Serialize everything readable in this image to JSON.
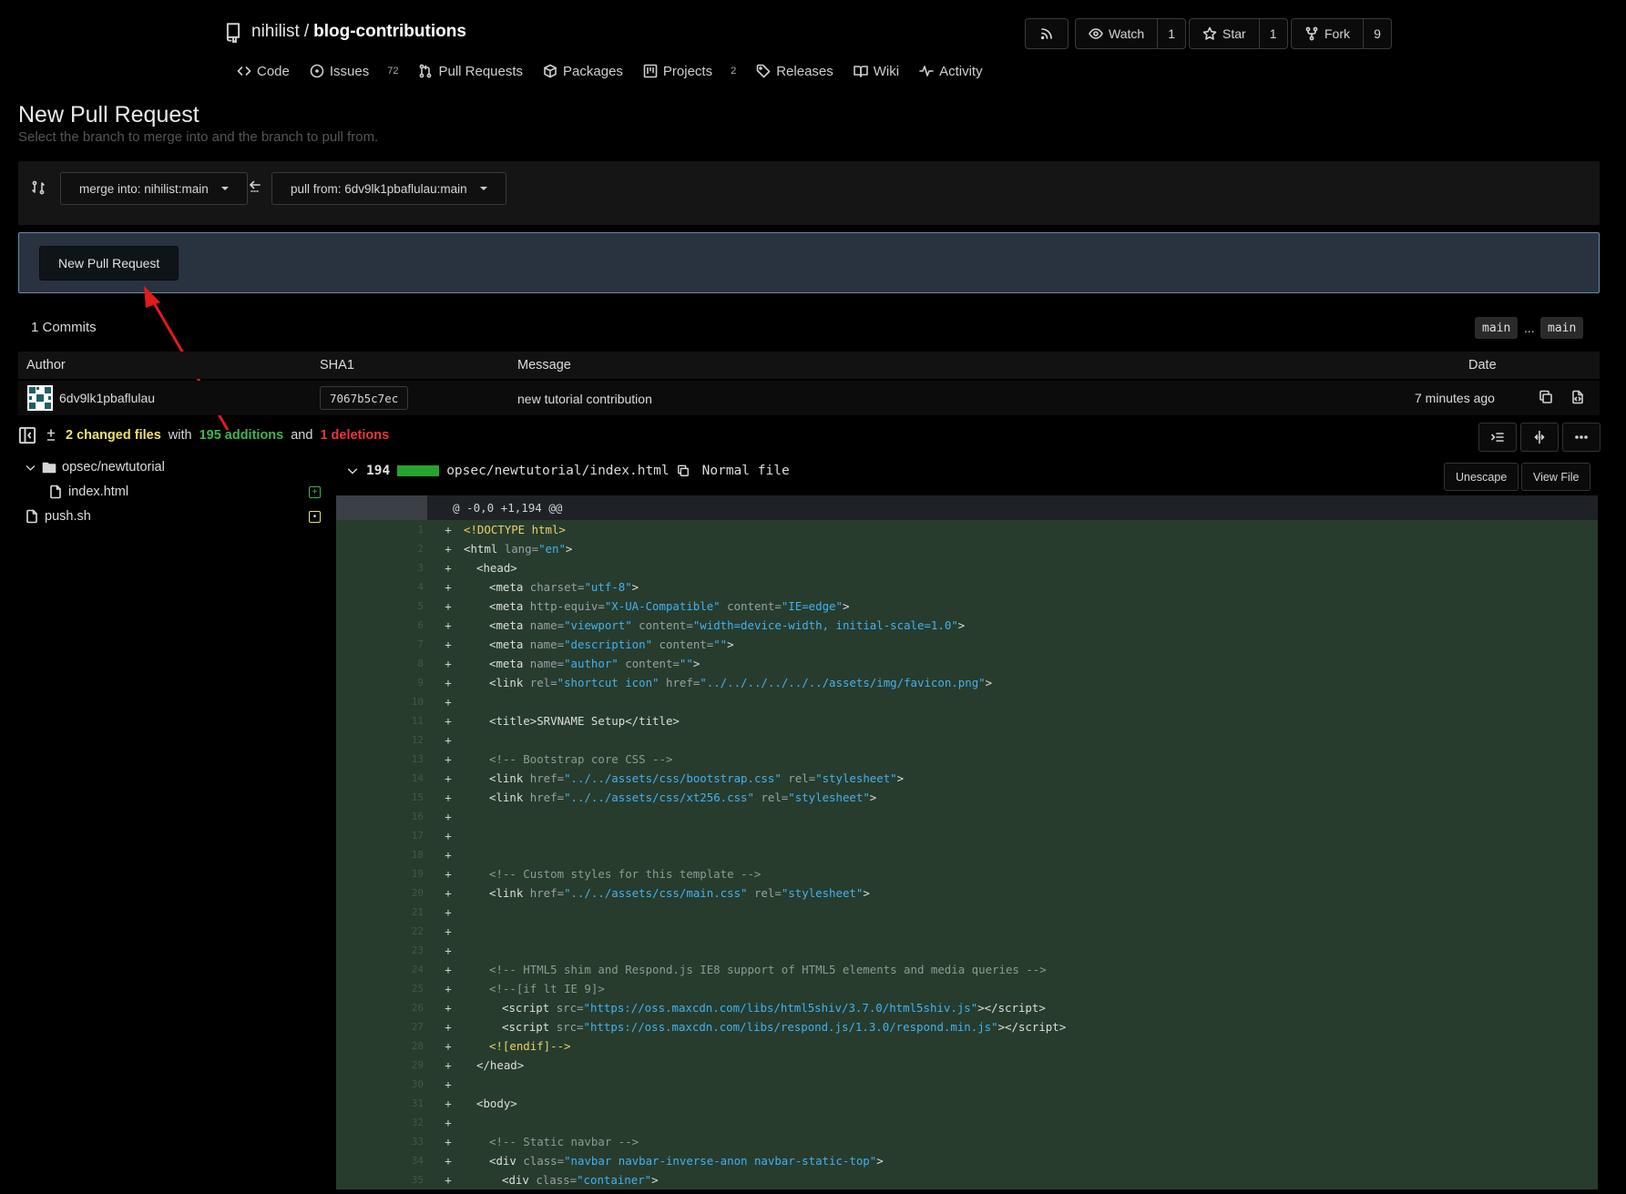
{
  "repo": {
    "owner": "nihilist",
    "name": "blog-contributions"
  },
  "header_buttons": {
    "watch": {
      "label": "Watch",
      "count": "1"
    },
    "star": {
      "label": "Star",
      "count": "1"
    },
    "fork": {
      "label": "Fork",
      "count": "9"
    }
  },
  "tabs": [
    {
      "label": "Code",
      "icon": "code-icon"
    },
    {
      "label": "Issues",
      "icon": "issue-icon",
      "badge": "72"
    },
    {
      "label": "Pull Requests",
      "icon": "pull-request-icon"
    },
    {
      "label": "Packages",
      "icon": "package-icon"
    },
    {
      "label": "Projects",
      "icon": "project-icon",
      "badge": "2"
    },
    {
      "label": "Releases",
      "icon": "tag-icon"
    },
    {
      "label": "Wiki",
      "icon": "book-icon"
    },
    {
      "label": "Activity",
      "icon": "pulse-icon"
    }
  ],
  "page": {
    "title": "New Pull Request",
    "subtitle": "Select the branch to merge into and the branch to pull from."
  },
  "branches": {
    "merge_into": "merge into: nihilist:main",
    "pull_from": "pull from: 6dv9lk1pbaflulau:main"
  },
  "pr_button": "New Pull Request",
  "commits": {
    "label": "1 Commits",
    "base_ref": "main",
    "dots": "...",
    "head_ref": "main",
    "columns": {
      "author": "Author",
      "sha": "SHA1",
      "message": "Message",
      "date": "Date"
    },
    "rows": [
      {
        "author": "6dv9lk1pbaflulau",
        "sha": "7067b5c7ec",
        "message": "new tutorial contribution",
        "date": "7 minutes ago"
      }
    ]
  },
  "stats": {
    "changed_files": "2 changed files",
    "with": "with",
    "additions": "195 additions",
    "and": "and",
    "deletions": "1 deletions"
  },
  "file_tree": {
    "folder": "opsec/newtutorial",
    "nested_file": "index.html",
    "root_file": "push.sh"
  },
  "diff_file": {
    "count": "194",
    "path": "opsec/newtutorial/index.html",
    "type": "Normal file",
    "unescape": "Unescape",
    "view_file": "View File",
    "hunk": "@ -0,0 +1,194 @@",
    "line_count": 35
  },
  "colors": {
    "background": "#000000",
    "pr_box": "#29333f",
    "addition_bg": "#273c2d",
    "additions_text": "#3fb650",
    "deletions_text": "#ec3636",
    "changed_files_text": "#f0e16a",
    "attr_value": "#44b0f0"
  }
}
